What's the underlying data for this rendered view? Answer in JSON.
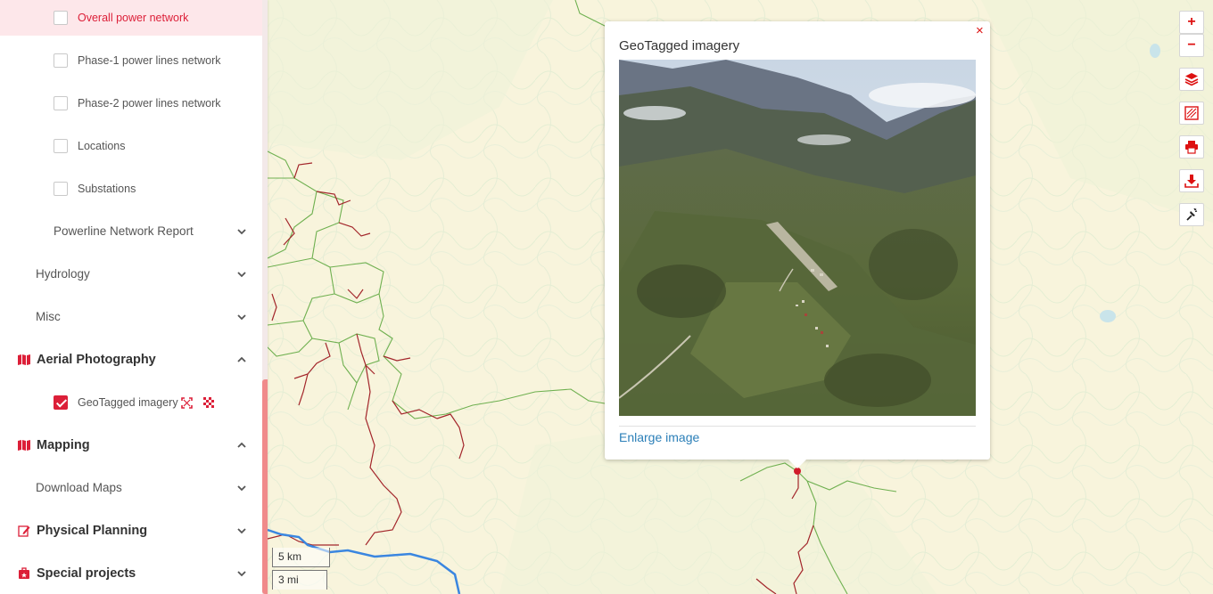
{
  "sidebar": {
    "layers": [
      {
        "label": "Overall power network",
        "checked": false,
        "highlighted": true
      },
      {
        "label": "Phase-1 power lines network",
        "checked": false
      },
      {
        "label": "Phase-2 power lines network",
        "checked": false
      },
      {
        "label": "Locations",
        "checked": false
      },
      {
        "label": "Substations",
        "checked": false
      }
    ],
    "powerline_report": "Powerline Network Report",
    "hydrology": "Hydrology",
    "misc": "Misc",
    "aerial": {
      "label": "Aerial Photography",
      "icon": "map-icon"
    },
    "geotagged": {
      "label": "GeoTagged imagery",
      "checked": true
    },
    "mapping": {
      "label": "Mapping",
      "icon": "map-icon"
    },
    "download_maps": "Download Maps",
    "physical": {
      "label": "Physical Planning",
      "icon": "edit-icon"
    },
    "special": {
      "label": "Special projects",
      "icon": "briefcase-icon"
    }
  },
  "popup": {
    "title": "GeoTagged imagery",
    "close": "×",
    "link": "Enlarge image"
  },
  "controls": {
    "zoom_in": "+",
    "zoom_out": "−",
    "icons": [
      "layers-icon",
      "legend-icon",
      "print-icon",
      "download-icon",
      "pin-icon"
    ]
  },
  "scale": {
    "km": "5 km",
    "mi": "3 mi"
  },
  "colors": {
    "accent": "#dc1f38",
    "power_line": "#a92f2f",
    "road": "#6ab04c",
    "river": "#3a86e0"
  }
}
